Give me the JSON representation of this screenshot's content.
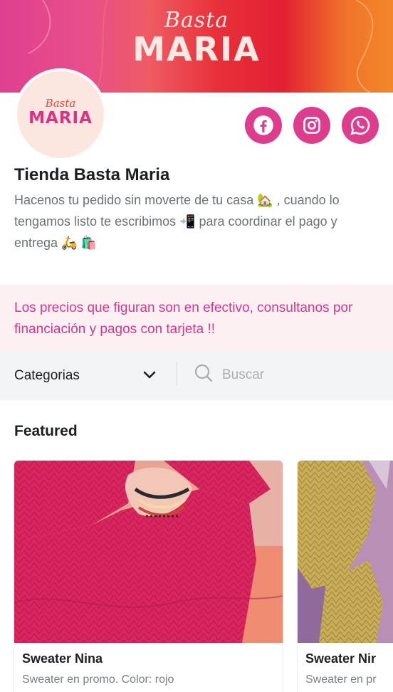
{
  "brand": {
    "logo_line1": "Basta",
    "logo_line2": "MARIA",
    "accent_color": "#de3d8e"
  },
  "store": {
    "name": "Tienda Basta Maria",
    "description": "Hacenos tu pedido sin moverte de tu casa 🏡 , cuando lo tengamos listo te escribimos 📲 para coordinar el pago y entrega 🛵 🛍️"
  },
  "social": {
    "facebook_icon": "facebook-icon",
    "instagram_icon": "instagram-icon",
    "whatsapp_icon": "whatsapp-icon"
  },
  "notice": {
    "text": "Los precios que figuran son en efectivo, consultanos por financiación y pagos con tarjeta !!"
  },
  "filter": {
    "categories_label": "Categorias",
    "search_placeholder": "Buscar"
  },
  "featured": {
    "heading": "Featured",
    "products": [
      {
        "title": "Sweater Nina",
        "subtitle": "Sweater en promo. Color: rojo"
      },
      {
        "title": "Sweater Nir",
        "subtitle": "Sweater en pr"
      }
    ]
  }
}
